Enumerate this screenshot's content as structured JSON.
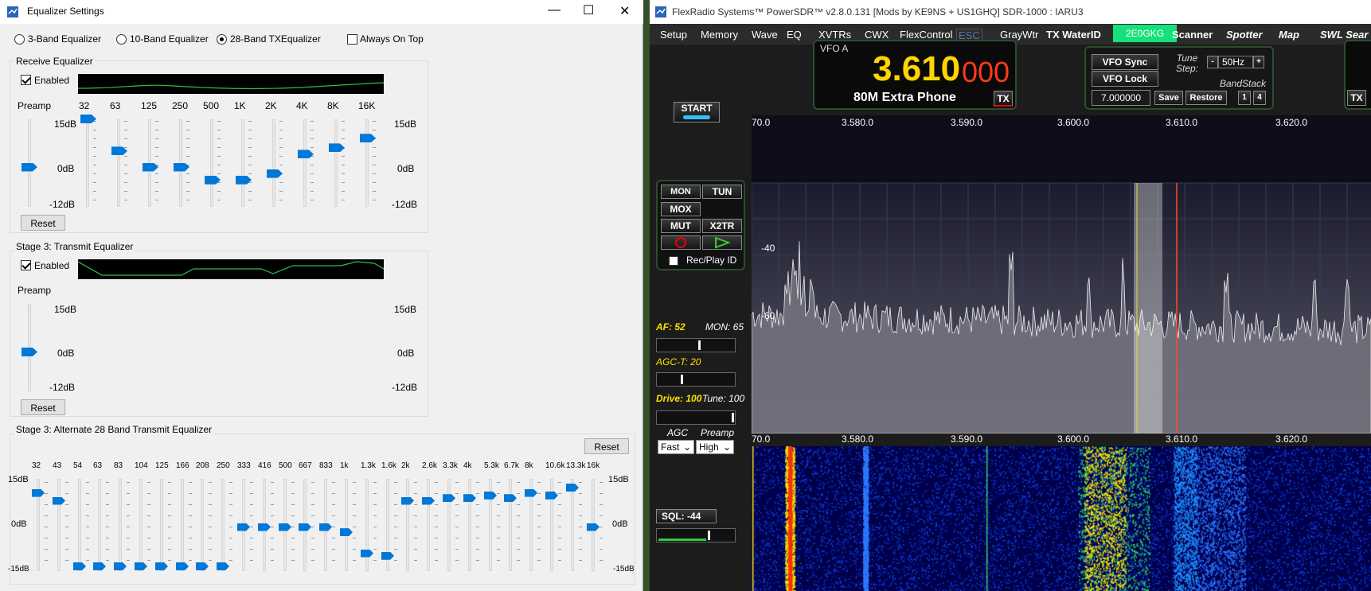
{
  "eq": {
    "title": "Equalizer Settings",
    "win_min": "—",
    "win_max": "☐",
    "win_close": "✕",
    "radio_3": "3-Band Equalizer",
    "radio_10": "10-Band Equalizer",
    "radio_28": "28-Band TXEqualizer",
    "always_on_top": "Always On Top",
    "receive": {
      "title": "Receive Equalizer",
      "enabled": "Enabled",
      "preamp": "Preamp",
      "bands": [
        "32",
        "63",
        "125",
        "250",
        "500",
        "1K",
        "2K",
        "4K",
        "8K",
        "16K"
      ],
      "db_top": "15dB",
      "db_mid": "0dB",
      "db_bot": "-12dB",
      "reset": "Reset",
      "preamp_value_db": 0,
      "band_values_db": [
        15,
        5,
        0,
        0,
        -4,
        -4,
        -2,
        4,
        6,
        9
      ]
    },
    "stage3": {
      "title": "Stage 3: Transmit Equalizer",
      "enabled": "Enabled",
      "preamp": "Preamp",
      "db_top": "15dB",
      "db_mid": "0dB",
      "db_bot": "-12dB",
      "reset": "Reset",
      "preamp_value_db": 0
    },
    "alt28": {
      "title": "Stage 3:  Alternate 28 Band Transmit Equalizer",
      "reset": "Reset",
      "db_top": "15dB",
      "db_mid": "0dB",
      "db_bot": "-15dB",
      "bands": [
        "32",
        "43",
        "54",
        "63",
        "83",
        "104",
        "125",
        "166",
        "208",
        "250",
        "333",
        "416",
        "500",
        "667",
        "833",
        "1k",
        "1.3k",
        "1.6k",
        "2k",
        "2.6k",
        "3.3k",
        "4k",
        "5.3k",
        "6.7k",
        "8k",
        "10.6k",
        "13.3k",
        "16k"
      ],
      "values_db": [
        13,
        10,
        -15,
        -15,
        -15,
        -15,
        -15,
        -15,
        -15,
        -15,
        0,
        0,
        0,
        0,
        0,
        -2,
        -10,
        -11,
        10,
        10,
        11,
        11,
        12,
        11,
        13,
        12,
        15,
        0
      ]
    }
  },
  "sdr": {
    "title": "FlexRadio Systems™  PowerSDR™  v2.8.0.131   [Mods by KE9NS + US1GHQ]   SDR-1000 : IARU3",
    "menu": [
      "Setup",
      "Memory",
      "Wave",
      "EQ",
      "XVTRs",
      "CWX",
      "FlexControl",
      "ESC",
      "GrayWtr"
    ],
    "menu_bold": [
      "TX WaterID",
      "2E0GKG",
      "Scanner",
      "Spotter",
      "Map",
      "SWL Sear"
    ],
    "vfoa_label": "VFO A",
    "freq_main": "3.610",
    "freq_sub": "000",
    "band": "80M Extra Phone",
    "tx": "TX",
    "vfo_sync": "VFO Sync",
    "vfo_lock": "VFO Lock",
    "tune_step_label": "Tune Step:",
    "tune_step": "50Hz",
    "minus": "-",
    "plus": "+",
    "bandstack": "BandStack",
    "bs_freq": "7.000000",
    "save": "Save",
    "restore": "Restore",
    "bs1": "1",
    "bs4": "4",
    "start": "START",
    "freq_ticks": [
      "70.0",
      "3.580.0",
      "3.590.0",
      "3.600.0",
      "3.610.0",
      "3.620.0"
    ],
    "db_ticks": [
      "-40",
      "-60"
    ],
    "mon": "MON",
    "tun": "TUN",
    "mox": "MOX",
    "mut": "MUT",
    "x2tr": "X2TR",
    "recplay": "Rec/Play ID",
    "af": "AF: 52",
    "mon_lvl": "MON: 65",
    "agct": "AGC-T:  20",
    "drive": "Drive: 100",
    "tune_lvl": "Tune: 100",
    "agc_label": "AGC",
    "preamp_label": "Preamp",
    "agc": "Fast",
    "preamp": "High",
    "sql": "SQL: -44",
    "tx_right": "TX",
    "colors": {
      "freq": "#ffd500",
      "freq_sub": "#ff3a1a",
      "callsign_bg": "#16e07a",
      "accent": "#0078d7"
    }
  }
}
